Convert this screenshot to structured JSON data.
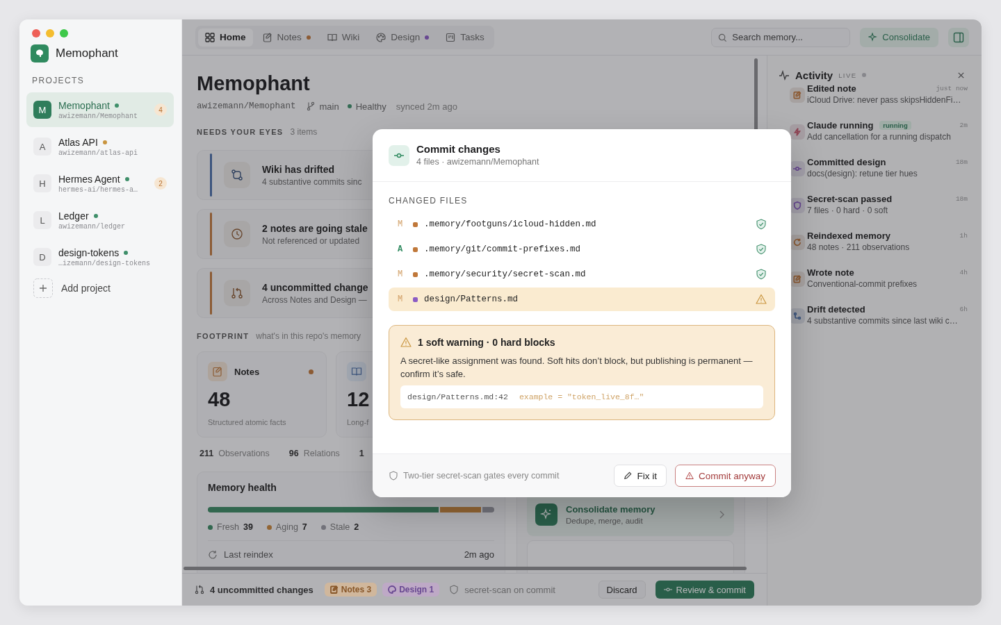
{
  "window": {
    "app_name": "Memophant"
  },
  "sidebar": {
    "section_title": "PROJECTS",
    "add_label": "Add project",
    "projects": [
      {
        "initial": "M",
        "name": "Memophant",
        "repo": "awizemann/Memophant",
        "color": "#3f8f6a",
        "badge": "4",
        "selected": true
      },
      {
        "initial": "A",
        "name": "Atlas API",
        "repo": "awizemann/atlas-api",
        "color": "#c9953f",
        "selected": false
      },
      {
        "initial": "H",
        "name": "Hermes Agent",
        "repo": "hermes-ai/hermes-a…",
        "color": "#3f8f6a",
        "badge": "2",
        "selected": false
      },
      {
        "initial": "L",
        "name": "Ledger",
        "repo": "awizemann/ledger",
        "color": "#3f8f6a",
        "selected": false
      },
      {
        "initial": "D",
        "name": "design-tokens",
        "repo": "…izemann/design-tokens",
        "color": "#3f8f6a",
        "selected": false
      }
    ]
  },
  "tabs": [
    {
      "label": "Home",
      "selected": true
    },
    {
      "label": "Notes",
      "selected": false,
      "color": "#8c5b34"
    },
    {
      "label": "Wiki",
      "selected": false
    },
    {
      "label": "Design",
      "selected": false,
      "color": "#684891"
    },
    {
      "label": "Tasks",
      "selected": false
    }
  ],
  "search": {
    "placeholder": "Search memory..."
  },
  "consolidate_button": "Consolidate",
  "header": {
    "title": "Memophant",
    "repo": "awizemann/Memophant",
    "branch": "main",
    "health": "Healthy",
    "synced": "synced 2m ago"
  },
  "needs": {
    "title": "NEEDS YOUR EYES",
    "count": "3 items",
    "items": [
      {
        "kind": "drift",
        "title": "Wiki has drifted",
        "subtitle": "4 substantive commits sinc",
        "color": "#3c557e"
      },
      {
        "kind": "stale",
        "title": "2 notes are going stale",
        "subtitle": "Not referenced or updated",
        "color": "#8c5b34"
      },
      {
        "kind": "changes",
        "title": "4 uncommitted change",
        "subtitle": "Across Notes and Design —",
        "color": "#8c5b34"
      }
    ]
  },
  "footprint": {
    "title": "FOOTPRINT",
    "subtitle": "what's in this repo's memory",
    "cards": [
      {
        "kind": "notes",
        "label": "Notes",
        "value": "48",
        "caption": "Structured atomic facts",
        "color": "#8c5b34"
      },
      {
        "kind": "wiki",
        "value": "12",
        "caption": "Long-f"
      }
    ]
  },
  "stats": [
    {
      "value": "211",
      "label": "Observations"
    },
    {
      "value": "96",
      "label": "Relations"
    },
    {
      "value": "1"
    }
  ],
  "health": {
    "title": "Memory health",
    "reindex_label": "Last reindex",
    "reindex_time": "2m ago",
    "segments": [
      {
        "label": "Fresh",
        "count": "39",
        "color": "#32674f"
      },
      {
        "label": "Aging",
        "count": "7",
        "color": "#926534"
      },
      {
        "label": "Stale",
        "count": "2",
        "color": "#72727a"
      }
    ]
  },
  "actions": [
    {
      "title": "Consolidate memory",
      "subtitle": "Dedupe, merge, audit"
    }
  ],
  "bottom_bar": {
    "changes": "4 uncommitted changes",
    "chips": [
      {
        "label": "Notes 3",
        "color": "#875628"
      },
      {
        "label": "Design 1",
        "color": "#684891"
      }
    ],
    "scan": "secret-scan on commit",
    "discard": "Discard",
    "commit": "Review & commit"
  },
  "activity": {
    "title": "Activity",
    "live": "LIVE",
    "items": [
      {
        "kind": "note",
        "title": "Edited note",
        "detail": "iCloud Drive: never pass skipsHiddenFi…",
        "time": "just now",
        "color": "#8c5b34"
      },
      {
        "kind": "agent",
        "title": "Claude running",
        "badge": "running",
        "detail": "Add cancellation for a running dispatch",
        "time": "2m",
        "color": "#8f4454"
      },
      {
        "kind": "commit",
        "title": "Committed design",
        "detail": "docs(design): retune tier hues",
        "time": "18m",
        "color": "#684891"
      },
      {
        "kind": "scan",
        "title": "Secret-scan passed",
        "detail": "7 files · 0 hard · 0 soft",
        "time": "18m",
        "color": "#684891"
      },
      {
        "kind": "reindex",
        "title": "Reindexed memory",
        "detail": "48 notes · 211 observations",
        "time": "1h",
        "color": "#8c5b34"
      },
      {
        "kind": "note",
        "title": "Wrote note",
        "detail": "Conventional-commit prefixes",
        "time": "4h",
        "color": "#8c5b34"
      },
      {
        "kind": "drift",
        "title": "Drift detected",
        "detail": "4 substantive commits since last wiki c…",
        "time": "6h",
        "color": "#3c557e"
      }
    ]
  },
  "modal": {
    "title": "Commit changes",
    "subtitle": "4 files · awizemann/Memophant",
    "section": "CHANGED FILES",
    "files": [
      {
        "status": "M",
        "kind": "modified",
        "path": ".memory/footguns/icloud-hidden.md",
        "color": "#c0783a",
        "flagged": false
      },
      {
        "status": "A",
        "kind": "added",
        "path": ".memory/git/commit-prefixes.md",
        "color": "#c0783a",
        "flagged": false
      },
      {
        "status": "M",
        "kind": "modified",
        "path": ".memory/security/secret-scan.md",
        "color": "#c0783a",
        "flagged": false
      },
      {
        "status": "M",
        "kind": "modified",
        "path": "design/Patterns.md",
        "color": "#8b5cc4",
        "flagged": true
      }
    ],
    "warning": {
      "title": "1 soft warning · 0 hard blocks",
      "body": "A secret-like assignment was found. Soft hits don’t block, but publishing is permanent — confirm it’s safe.",
      "location": "design/Patterns.md:42",
      "snippet": "example = \"token_live_8f…\""
    },
    "footer_note": "Two-tier secret-scan gates every commit",
    "fix_button": "Fix it",
    "commit_button": "Commit anyway"
  }
}
